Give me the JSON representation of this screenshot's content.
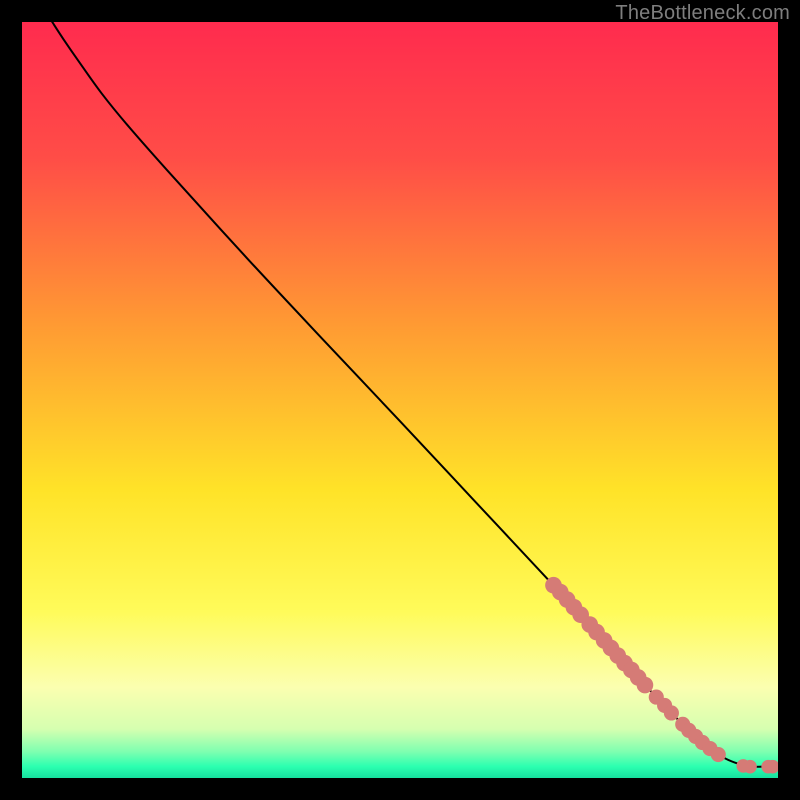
{
  "attribution": "TheBottleneck.com",
  "chart_data": {
    "type": "line",
    "title": "",
    "xlabel": "",
    "ylabel": "",
    "xlim": [
      0,
      100
    ],
    "ylim": [
      0,
      100
    ],
    "gradient_stops": [
      {
        "offset": 0.0,
        "color": "#ff2b4e"
      },
      {
        "offset": 0.18,
        "color": "#ff4d47"
      },
      {
        "offset": 0.4,
        "color": "#ff9a33"
      },
      {
        "offset": 0.62,
        "color": "#ffe328"
      },
      {
        "offset": 0.78,
        "color": "#fffb5a"
      },
      {
        "offset": 0.88,
        "color": "#fbffb0"
      },
      {
        "offset": 0.935,
        "color": "#d6ffb0"
      },
      {
        "offset": 0.965,
        "color": "#7fffb0"
      },
      {
        "offset": 0.985,
        "color": "#2bffb0"
      },
      {
        "offset": 1.0,
        "color": "#16e09e"
      }
    ],
    "curve": [
      {
        "x": 4.0,
        "y": 100.0
      },
      {
        "x": 5.5,
        "y": 97.7
      },
      {
        "x": 7.5,
        "y": 94.8
      },
      {
        "x": 10.5,
        "y": 90.6
      },
      {
        "x": 14.0,
        "y": 86.3
      },
      {
        "x": 20.0,
        "y": 79.5
      },
      {
        "x": 30.0,
        "y": 68.5
      },
      {
        "x": 40.0,
        "y": 57.8
      },
      {
        "x": 50.0,
        "y": 47.2
      },
      {
        "x": 60.0,
        "y": 36.5
      },
      {
        "x": 70.0,
        "y": 25.8
      },
      {
        "x": 78.0,
        "y": 17.0
      },
      {
        "x": 84.0,
        "y": 10.6
      },
      {
        "x": 88.0,
        "y": 6.5
      },
      {
        "x": 91.0,
        "y": 3.9
      },
      {
        "x": 93.0,
        "y": 2.6
      },
      {
        "x": 95.0,
        "y": 1.8
      },
      {
        "x": 96.5,
        "y": 1.5
      },
      {
        "x": 98.0,
        "y": 1.5
      },
      {
        "x": 99.3,
        "y": 1.5
      }
    ],
    "markers": [
      {
        "x": 70.3,
        "y": 25.5,
        "r": 1.1
      },
      {
        "x": 71.2,
        "y": 24.6,
        "r": 1.1
      },
      {
        "x": 72.1,
        "y": 23.6,
        "r": 1.1
      },
      {
        "x": 73.0,
        "y": 22.6,
        "r": 1.1
      },
      {
        "x": 73.9,
        "y": 21.6,
        "r": 1.1
      },
      {
        "x": 75.1,
        "y": 20.3,
        "r": 1.1
      },
      {
        "x": 76.0,
        "y": 19.3,
        "r": 1.1
      },
      {
        "x": 77.0,
        "y": 18.2,
        "r": 1.1
      },
      {
        "x": 77.9,
        "y": 17.2,
        "r": 1.1
      },
      {
        "x": 78.8,
        "y": 16.2,
        "r": 1.1
      },
      {
        "x": 79.7,
        "y": 15.2,
        "r": 1.1
      },
      {
        "x": 80.6,
        "y": 14.3,
        "r": 1.1
      },
      {
        "x": 81.5,
        "y": 13.3,
        "r": 1.1
      },
      {
        "x": 82.4,
        "y": 12.3,
        "r": 1.1
      },
      {
        "x": 83.9,
        "y": 10.7,
        "r": 1.0
      },
      {
        "x": 85.0,
        "y": 9.6,
        "r": 1.0
      },
      {
        "x": 85.9,
        "y": 8.6,
        "r": 1.0
      },
      {
        "x": 87.4,
        "y": 7.1,
        "r": 1.0
      },
      {
        "x": 88.2,
        "y": 6.3,
        "r": 1.0
      },
      {
        "x": 89.1,
        "y": 5.5,
        "r": 1.0
      },
      {
        "x": 90.0,
        "y": 4.7,
        "r": 1.0
      },
      {
        "x": 91.0,
        "y": 3.9,
        "r": 1.0
      },
      {
        "x": 92.1,
        "y": 3.1,
        "r": 1.0
      },
      {
        "x": 95.4,
        "y": 1.6,
        "r": 0.9
      },
      {
        "x": 96.3,
        "y": 1.5,
        "r": 0.9
      },
      {
        "x": 98.7,
        "y": 1.5,
        "r": 0.9
      },
      {
        "x": 99.3,
        "y": 1.5,
        "r": 0.9
      }
    ],
    "marker_color": "#d57b76",
    "curve_color": "#000000"
  }
}
